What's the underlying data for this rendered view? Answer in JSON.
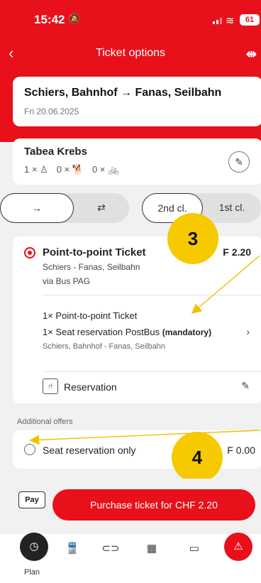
{
  "status": {
    "time": "15:42",
    "battery": "61"
  },
  "nav": {
    "title": "Ticket options"
  },
  "route": {
    "title": "Schiers, Bahnhof → Fanas, Seilbahn",
    "date": "Fri 20.06.2025"
  },
  "passenger": {
    "name": "Tabea Krebs",
    "adults": "1 × ♙",
    "dogs": "0 × 🐕",
    "bikes": "0 × 🚲"
  },
  "direction": {
    "one_way": "→",
    "return": "⇄"
  },
  "class": {
    "second": "2nd cl.",
    "first": "1st cl."
  },
  "ticket": {
    "title": "Point-to-point Ticket",
    "price": "F 2.20",
    "route": "Schiers - Fanas, Seilbahn",
    "via": "via Bus PAG",
    "item1": "1× Point-to-point Ticket",
    "item2": "1× Seat reservation PostBus",
    "item2_note": "(mandatory)",
    "item_route": "Schiers, Bahnhof - Fanas, Seilbahn",
    "reservation_label": "Reservation"
  },
  "additional": {
    "label": "Additional offers",
    "offer_title": "Seat reservation only",
    "offer_price": "F 0.00"
  },
  "badges": {
    "b3": "3",
    "b4": "4"
  },
  "purchase": {
    "applepay": "Pay",
    "button": "Purchase ticket for CHF 2.20"
  },
  "tabs": {
    "plan_label": "Plan"
  },
  "colors": {
    "brand_red": "#e8101a",
    "badge_yellow": "#f7c900",
    "arrow_yellow": "#f0c000"
  }
}
